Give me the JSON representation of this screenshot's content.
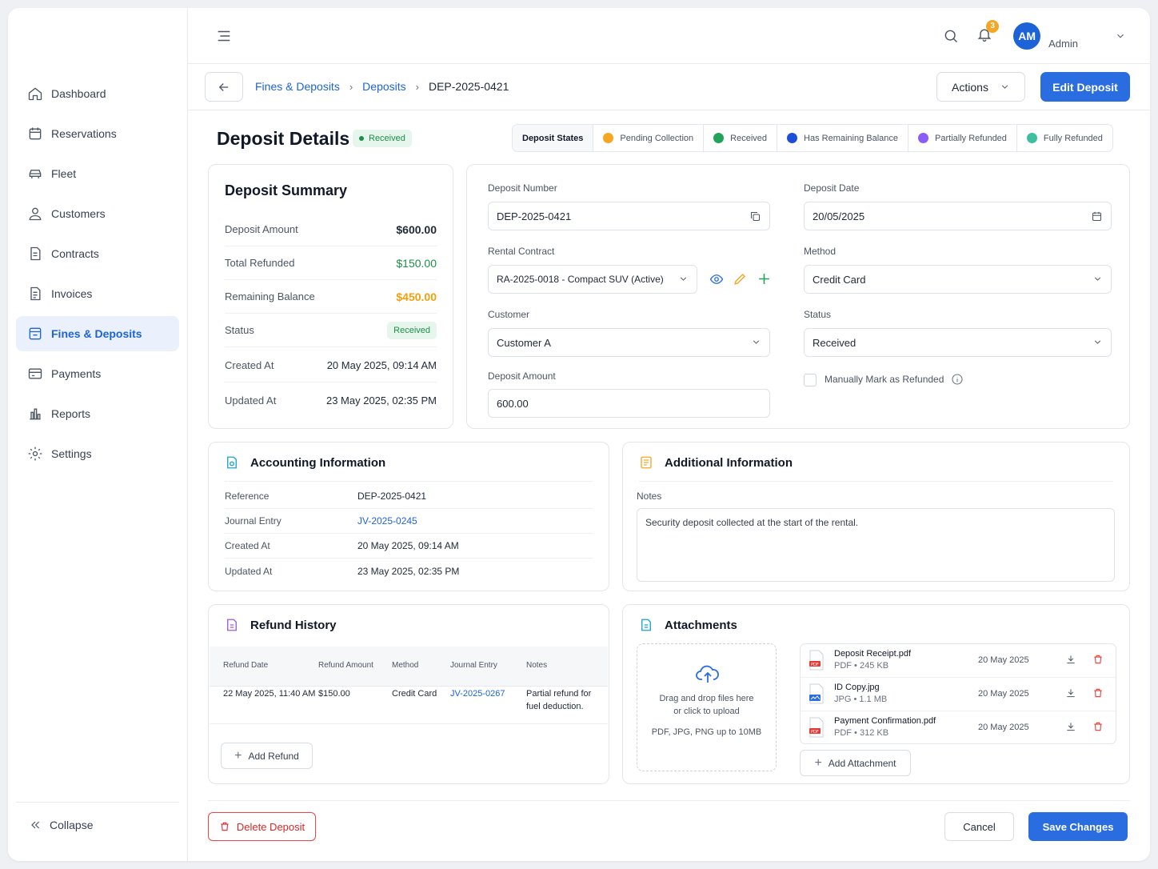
{
  "colors": {
    "accent": "#2a6de0",
    "success": "#1e8e4a",
    "warning": "#f5a623",
    "danger": "#dc2626",
    "purple": "#8b5cf6",
    "teal": "#3fbfa0"
  },
  "sidebar": {
    "items": [
      {
        "label": "Dashboard",
        "icon": "home-icon"
      },
      {
        "label": "Reservations",
        "icon": "calendar-icon"
      },
      {
        "label": "Fleet",
        "icon": "car-icon"
      },
      {
        "label": "Customers",
        "icon": "user-icon"
      },
      {
        "label": "Contracts",
        "icon": "document-icon"
      },
      {
        "label": "Invoices",
        "icon": "invoice-icon"
      },
      {
        "label": "Fines & Deposits",
        "icon": "fines-icon",
        "active": true
      },
      {
        "label": "Payments",
        "icon": "card-icon"
      },
      {
        "label": "Reports",
        "icon": "chart-icon"
      },
      {
        "label": "Settings",
        "icon": "gear-icon"
      }
    ],
    "collapse_label": "Collapse"
  },
  "topbar": {
    "notification_count": "3",
    "avatar_initials": "AM",
    "user_name": "Admin"
  },
  "breadcrumb": {
    "items": [
      "Fines & Deposits",
      "Deposits"
    ],
    "current": "DEP-2025-0421"
  },
  "header_actions": {
    "actions_label": "Actions",
    "edit_label": "Edit Deposit"
  },
  "page": {
    "title": "Deposit Details",
    "status_badge": "Received"
  },
  "states": [
    "Deposit States",
    "Pending Collection",
    "Received",
    "Has Remaining Balance",
    "Partially Refunded",
    "Fully Refunded"
  ],
  "summary": {
    "title": "Deposit Summary",
    "rows": [
      {
        "label": "Deposit Amount",
        "value": "$600.00"
      },
      {
        "label": "Total Refunded",
        "value": "$150.00"
      },
      {
        "label": "Remaining Balance",
        "value": "$450.00"
      },
      {
        "label": "Status",
        "value": "Received"
      },
      {
        "label": "Created At",
        "value": "20 May 2025, 09:14 AM"
      },
      {
        "label": "Updated At",
        "value": "23 May 2025, 02:35 PM"
      }
    ]
  },
  "form": {
    "deposit_number": {
      "label": "Deposit Number",
      "value": "DEP-2025-0421"
    },
    "deposit_date": {
      "label": "Deposit Date",
      "value": "20/05/2025"
    },
    "rental_contract": {
      "label": "Rental Contract",
      "value": "RA-2025-0018 - Compact SUV (Active)"
    },
    "method": {
      "label": "Method",
      "value": "Credit Card"
    },
    "customer": {
      "label": "Customer",
      "value": "Customer A"
    },
    "status": {
      "label": "Status",
      "value": "Received"
    },
    "deposit_amount": {
      "label": "Deposit Amount",
      "value": "600.00"
    },
    "manual_refund_label": "Manually Mark as Refunded"
  },
  "accounting": {
    "title": "Accounting Information",
    "rows": [
      {
        "label": "Reference",
        "value": "DEP-2025-0421"
      },
      {
        "label": "Journal Entry",
        "value": "JV-2025-0245"
      },
      {
        "label": "Created At",
        "value": "20 May 2025, 09:14 AM"
      },
      {
        "label": "Updated At",
        "value": "23 May 2025, 02:35 PM"
      }
    ]
  },
  "additional": {
    "title": "Additional Information",
    "notes_label": "Notes",
    "notes": "Security deposit collected at the start of the rental."
  },
  "refund_history": {
    "title": "Refund History",
    "columns": [
      "Refund Date",
      "Refund Amount",
      "Method",
      "Journal Entry",
      "Notes"
    ],
    "rows": [
      {
        "date": "22 May 2025, 11:40 AM",
        "amount": "$150.00",
        "method": "Credit Card",
        "journal": "JV-2025-0267",
        "notes_1": "Partial refund for",
        "notes_2": "fuel deduction."
      }
    ],
    "add_label": "Add Refund"
  },
  "attachments": {
    "title": "Attachments",
    "dropzone_line1": "Drag and drop files here",
    "dropzone_line2": "or click to upload",
    "dropzone_hint": "PDF, JPG, PNG up to 10MB",
    "files": [
      {
        "name": "Deposit Receipt.pdf",
        "meta": "PDF • 245 KB",
        "date": "20 May 2025",
        "type": "pdf"
      },
      {
        "name": "ID Copy.jpg",
        "meta": "JPG • 1.1 MB",
        "date": "20 May 2025",
        "type": "jpg"
      },
      {
        "name": "Payment Confirmation.pdf",
        "meta": "PDF • 312 KB",
        "date": "20 May 2025",
        "type": "pdf"
      }
    ],
    "add_label": "Add Attachment"
  },
  "footer": {
    "delete_label": "Delete Deposit",
    "cancel_label": "Cancel",
    "save_label": "Save Changes"
  }
}
